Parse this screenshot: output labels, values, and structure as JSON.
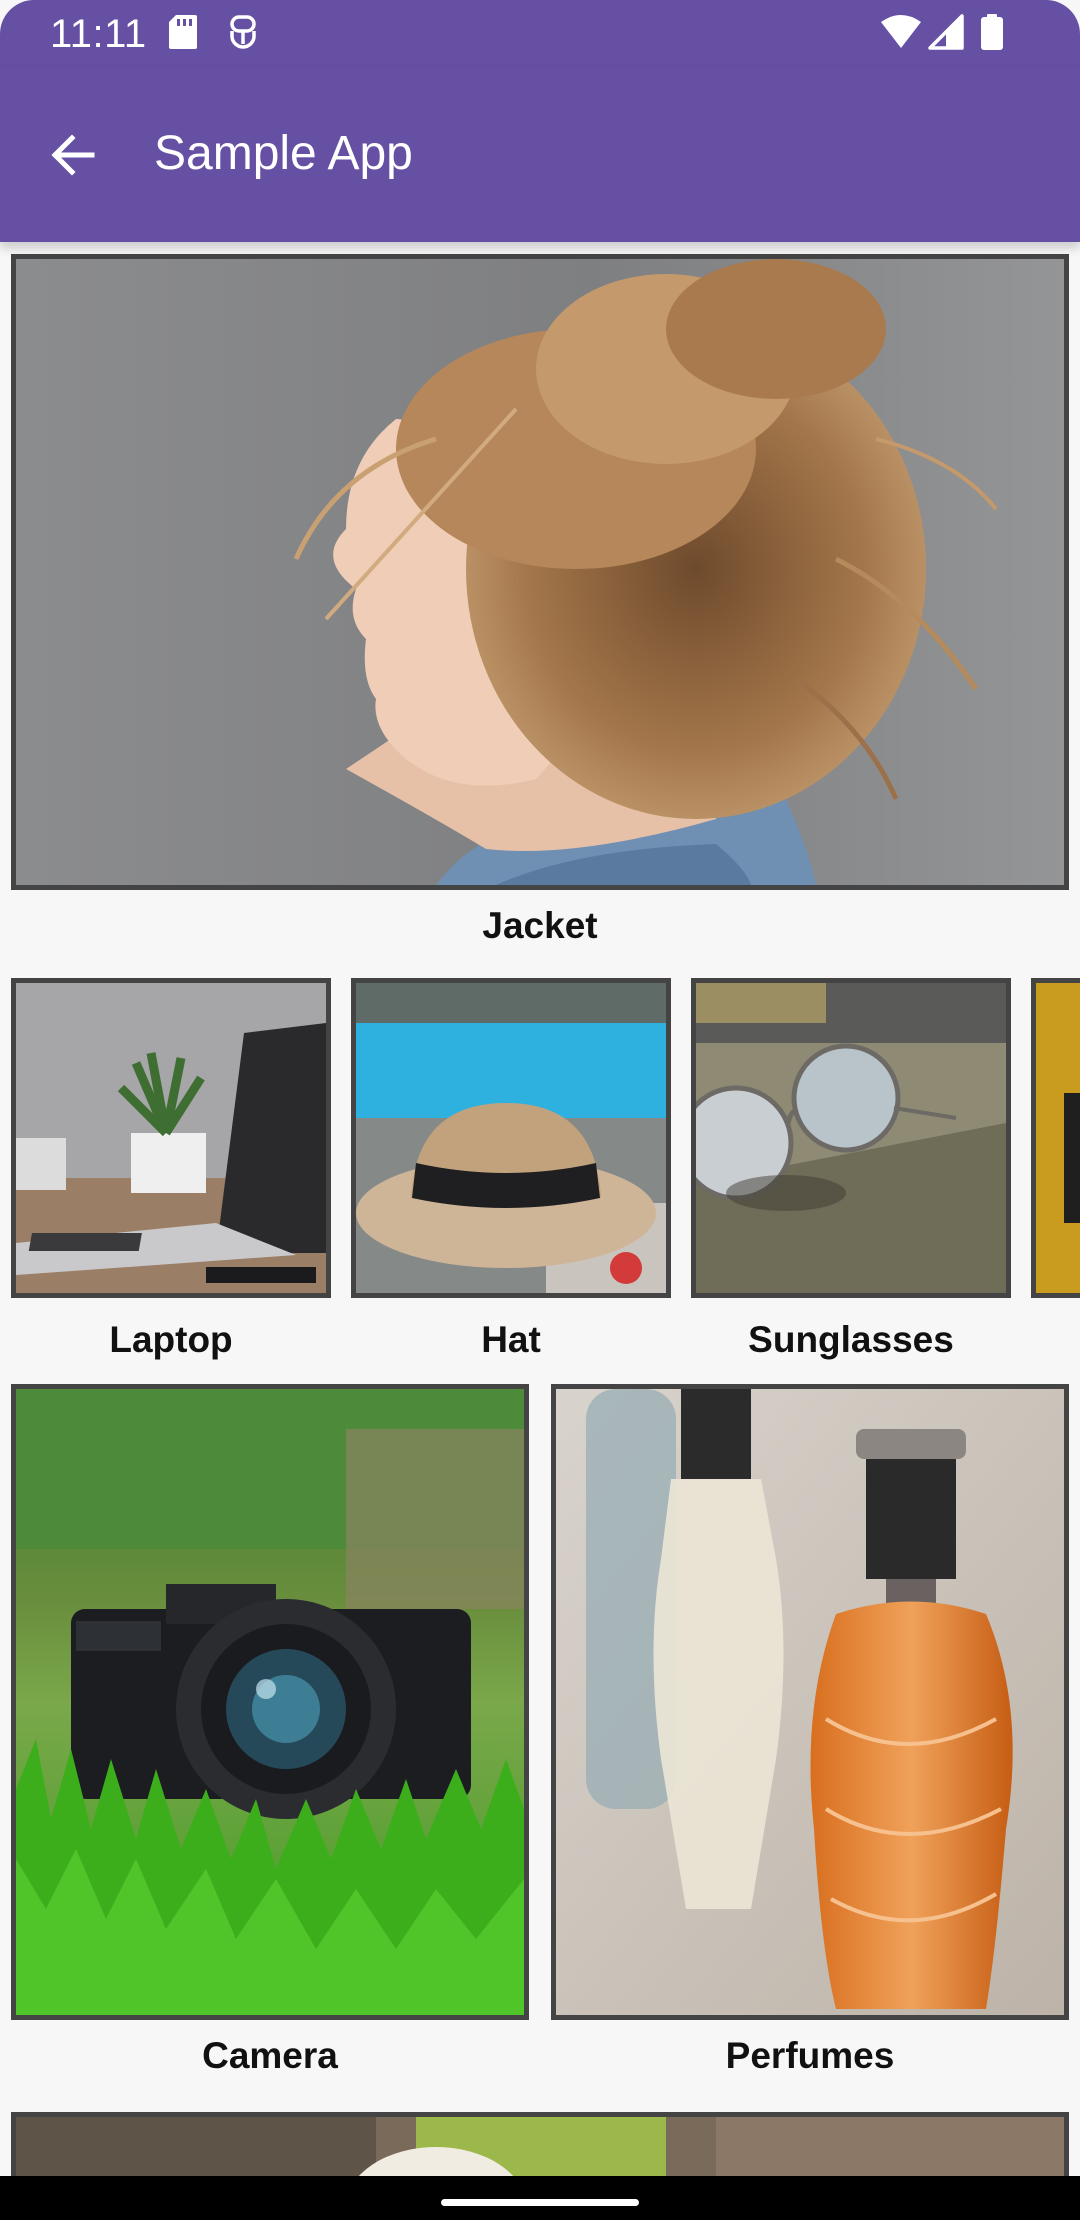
{
  "status_bar": {
    "time": "11:11"
  },
  "app_bar": {
    "title": "Sample App"
  },
  "products": {
    "featured": {
      "label": "Jacket"
    },
    "row": [
      {
        "label": "Laptop"
      },
      {
        "label": "Hat"
      },
      {
        "label": "Sunglasses"
      }
    ],
    "grid": [
      {
        "label": "Camera"
      },
      {
        "label": "Perfumes"
      }
    ]
  },
  "colors": {
    "primary": "#6650a4",
    "frame": "#444444",
    "background": "#f7f7f8"
  }
}
